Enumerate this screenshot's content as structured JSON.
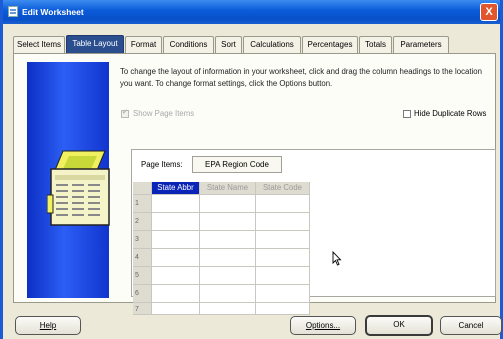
{
  "window": {
    "title": "Edit Worksheet",
    "close_label": "X"
  },
  "tabs": [
    {
      "label": "Select Items",
      "active": false
    },
    {
      "label": "Table Layout",
      "active": true
    },
    {
      "label": "Format",
      "active": false
    },
    {
      "label": "Conditions",
      "active": false
    },
    {
      "label": "Sort",
      "active": false
    },
    {
      "label": "Calculations",
      "active": false
    },
    {
      "label": "Percentages",
      "active": false
    },
    {
      "label": "Totals",
      "active": false
    },
    {
      "label": "Parameters",
      "active": false
    }
  ],
  "instructions": "To change the layout of information in your worksheet, click and drag the column headings to the location you want. To change format settings, click the Options button.",
  "options": {
    "show_page_items": {
      "label": "Show Page Items",
      "checked": true,
      "enabled": false
    },
    "hide_duplicate_rows": {
      "label": "Hide Duplicate Rows",
      "checked": false,
      "enabled": true
    }
  },
  "page_items": {
    "label": "Page Items:",
    "item": "EPA Region Code"
  },
  "table": {
    "columns": [
      "State Abbr",
      "State Name",
      "State Code"
    ],
    "selected_column": "State Abbr",
    "rows": [
      "1",
      "2",
      "3",
      "4",
      "5",
      "6",
      "7"
    ]
  },
  "buttons": {
    "help": "Help",
    "options": "Options...",
    "ok": "OK",
    "cancel": "Cancel"
  },
  "colors": {
    "accent": "#0a24b8",
    "active_tab": "#2b4e8f",
    "side_panel": "#1f4ae8"
  }
}
